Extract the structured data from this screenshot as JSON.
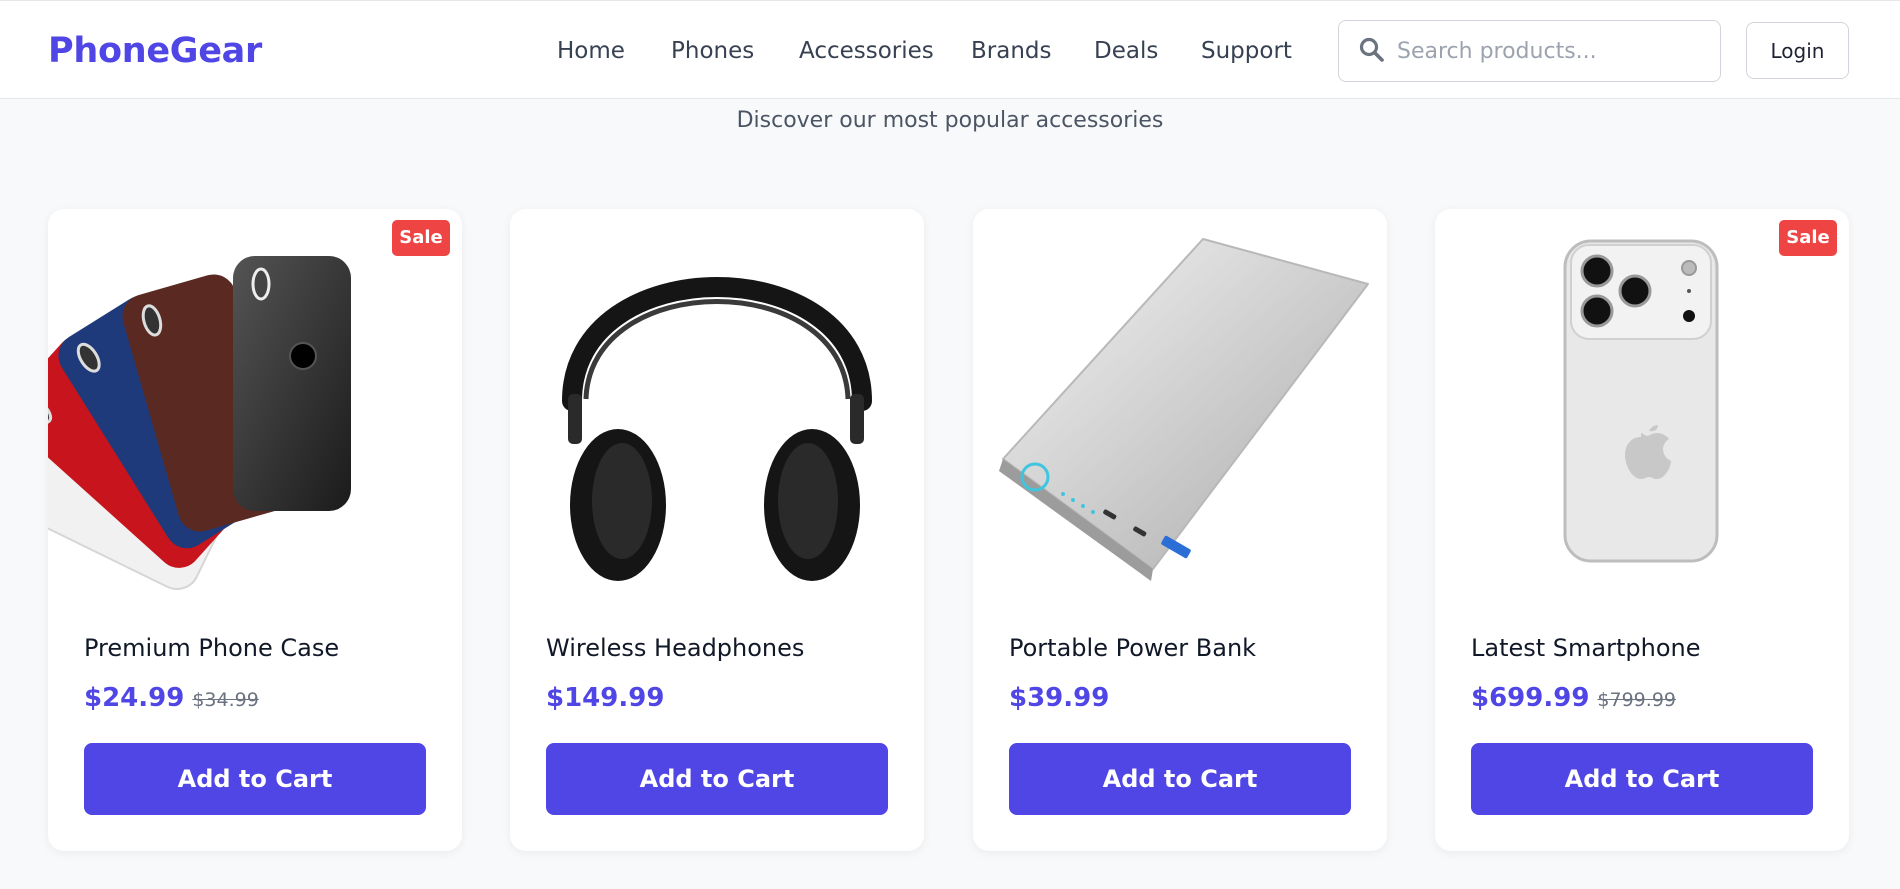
{
  "brand": {
    "name": "PhoneGear",
    "color": "#4f46e5"
  },
  "nav": {
    "items": [
      {
        "label": "Home"
      },
      {
        "label": "Phones"
      },
      {
        "label": "Accessories"
      },
      {
        "label": "Brands"
      },
      {
        "label": "Deals"
      },
      {
        "label": "Support"
      }
    ]
  },
  "search": {
    "placeholder": "Search products...",
    "value": "",
    "icon": "search-icon"
  },
  "header": {
    "login_label": "Login"
  },
  "section": {
    "subtitle": "Discover our most popular accessories"
  },
  "products": [
    {
      "name": "Premium Phone Case",
      "price": "$24.99",
      "old_price": "$34.99",
      "badge": "Sale",
      "cta": "Add to Cart",
      "image": "phone-case-fan"
    },
    {
      "name": "Wireless Headphones",
      "price": "$149.99",
      "cta": "Add to Cart",
      "image": "headphones"
    },
    {
      "name": "Portable Power Bank",
      "price": "$39.99",
      "cta": "Add to Cart",
      "image": "power-bank"
    },
    {
      "name": "Latest Smartphone",
      "price": "$699.99",
      "old_price": "$799.99",
      "badge": "Sale",
      "cta": "Add to Cart",
      "image": "smartphone"
    }
  ],
  "colors": {
    "accent": "#4f46e5",
    "sale": "#ef4444",
    "background": "#f8f9fb"
  }
}
